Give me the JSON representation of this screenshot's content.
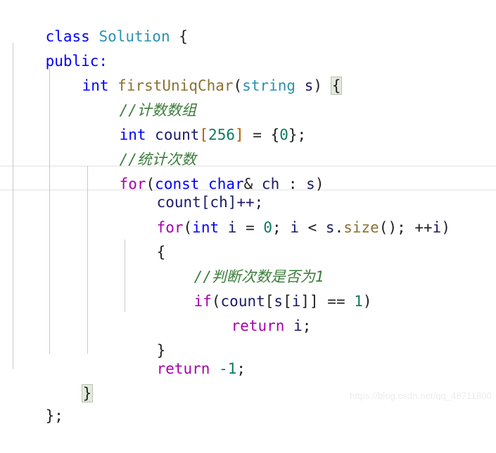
{
  "editor": {
    "language": "cpp",
    "background_color": "#ffffff",
    "font_size_px": 21,
    "line_height_px": 35,
    "indent_guide_color": "#c8c8c8",
    "current_line_border_color": "#e2e2e2",
    "brace_highlight_bg": "#e3e9de",
    "brace_highlight_border": "#b9c3b0"
  },
  "syntax_colors": {
    "keyword": "#0000ff",
    "type": "#2b91af",
    "function": "#8a7230",
    "control": "#a800a8",
    "number": "#0d7a5f",
    "identifier": "#1a1a66",
    "punctuation": "#1f1f1f",
    "bracket": "#b06000",
    "comment": "#3a7d3a"
  },
  "code": {
    "lines": [
      {
        "indent": 0,
        "text": "class Solution {"
      },
      {
        "indent": 0,
        "text": "public:"
      },
      {
        "indent": 1,
        "text": "int firstUniqChar(string s) {"
      },
      {
        "indent": 2,
        "text": "//计数数组"
      },
      {
        "indent": 2,
        "text": "int count[256] = {0};"
      },
      {
        "indent": 2,
        "text": "//统计次数"
      },
      {
        "indent": 2,
        "text": "for(const char& ch : s)"
      },
      {
        "indent": 3,
        "text": "count[ch]++;"
      },
      {
        "indent": 3,
        "text": "for(int i = 0; i < s.size(); ++i)"
      },
      {
        "indent": 3,
        "text": "{"
      },
      {
        "indent": 4,
        "text": "//判断次数是否为1"
      },
      {
        "indent": 4,
        "text": "if(count[s[i]] == 1)"
      },
      {
        "indent": 5,
        "text": "return i;"
      },
      {
        "indent": 3,
        "text": "}"
      },
      {
        "indent": 3,
        "text": "return -1;"
      },
      {
        "indent": 1,
        "text": "}"
      },
      {
        "indent": 0,
        "text": "};"
      }
    ]
  },
  "tokens": {
    "class_kw": "class",
    "solution_type": "Solution",
    "open_brace": "{",
    "close_brace": "}",
    "public_kw": "public:",
    "int_kw": "int",
    "fn_name": "firstUniqChar",
    "string_type": "string",
    "param_s": "s",
    "comment_count_array": "//计数数组",
    "count_ident": "count",
    "num_256": "256",
    "num_0": "0",
    "comment_tally": "//统计次数",
    "for_kw": "for",
    "const_kw": "const",
    "char_kw": "char",
    "ch_ident": "ch",
    "count_ch_inc": "count[ch]++;",
    "i_ident": "i",
    "size_fn": "size",
    "comment_check_once": "//判断次数是否为1",
    "if_kw": "if",
    "num_1": "1",
    "return_kw": "return",
    "neg_one": "-1",
    "end_class": "};"
  },
  "watermark": {
    "text": "https://blog.csdn.net/qq_48711800"
  }
}
